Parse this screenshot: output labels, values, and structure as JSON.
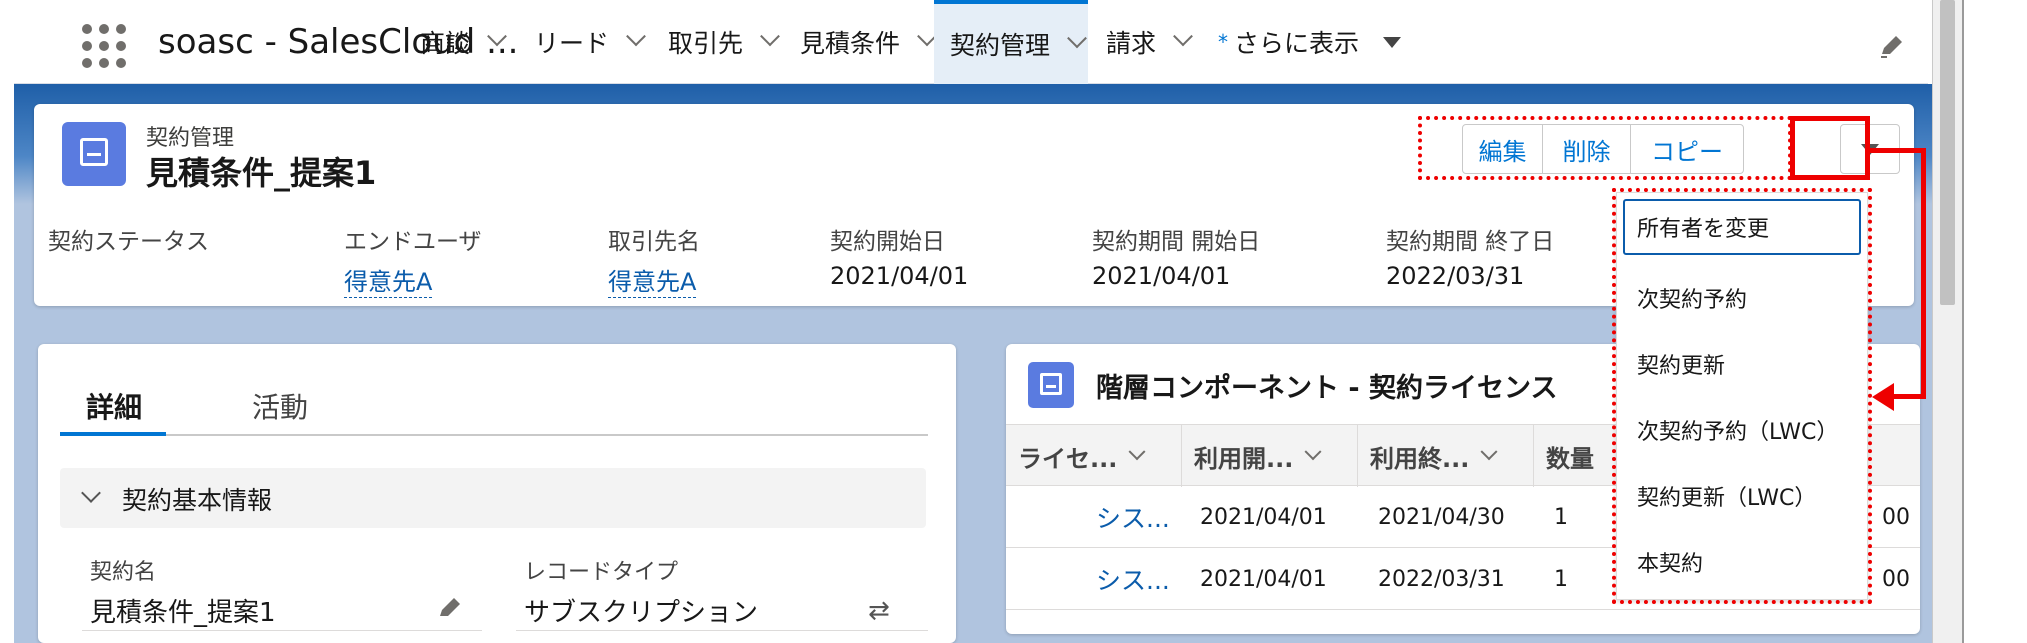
{
  "topnav": {
    "app_name": "soasc - SalesCloud ...",
    "tabs": [
      {
        "label": "商談"
      },
      {
        "label": "リード"
      },
      {
        "label": "取引先"
      },
      {
        "label": "見積条件"
      },
      {
        "label": "契約管理",
        "active": true
      },
      {
        "label": "請求"
      }
    ],
    "more_marker": "*",
    "more_label": "さらに表示"
  },
  "record": {
    "object_type": "契約管理",
    "name": "見積条件_提案1",
    "actions": [
      "編集",
      "削除",
      "コピー"
    ],
    "fields": [
      {
        "label": "契約ステータス",
        "value": ""
      },
      {
        "label": "エンドユーザ",
        "value": "得意先A",
        "link": true
      },
      {
        "label": "取引先名",
        "value": "得意先A",
        "link": true
      },
      {
        "label": "契約開始日",
        "value": "2021/04/01"
      },
      {
        "label": "契約期間 開始日",
        "value": "2021/04/01"
      },
      {
        "label": "契約期間 終了日",
        "value": "2022/03/31"
      }
    ]
  },
  "menu": {
    "items": [
      "所有者を変更",
      "次契約予約",
      "契約更新",
      "次契約予約（LWC）",
      "契約更新（LWC）",
      "本契約"
    ]
  },
  "detail": {
    "tabs": [
      "詳細",
      "活動"
    ],
    "section_title": "契約基本情報",
    "contract_name_label": "契約名",
    "contract_name_value": "見積条件_提案1",
    "record_type_label": "レコードタイプ",
    "record_type_value": "サブスクリプション"
  },
  "related": {
    "title": "階層コンポーネント - 契約ライセンス",
    "columns": [
      "ライセ...",
      "利用開...",
      "利用終...",
      "数量"
    ],
    "rows": [
      {
        "name": "シス...",
        "start": "2021/04/01",
        "end": "2021/04/30",
        "qty": "1",
        "tail": "00"
      },
      {
        "name": "シス...",
        "start": "2021/04/01",
        "end": "2022/03/31",
        "qty": "1",
        "tail": "00"
      }
    ]
  },
  "colors": {
    "brand": "#0176d3",
    "highlight": "#ee0000",
    "record_icon": "#5a7be0"
  }
}
